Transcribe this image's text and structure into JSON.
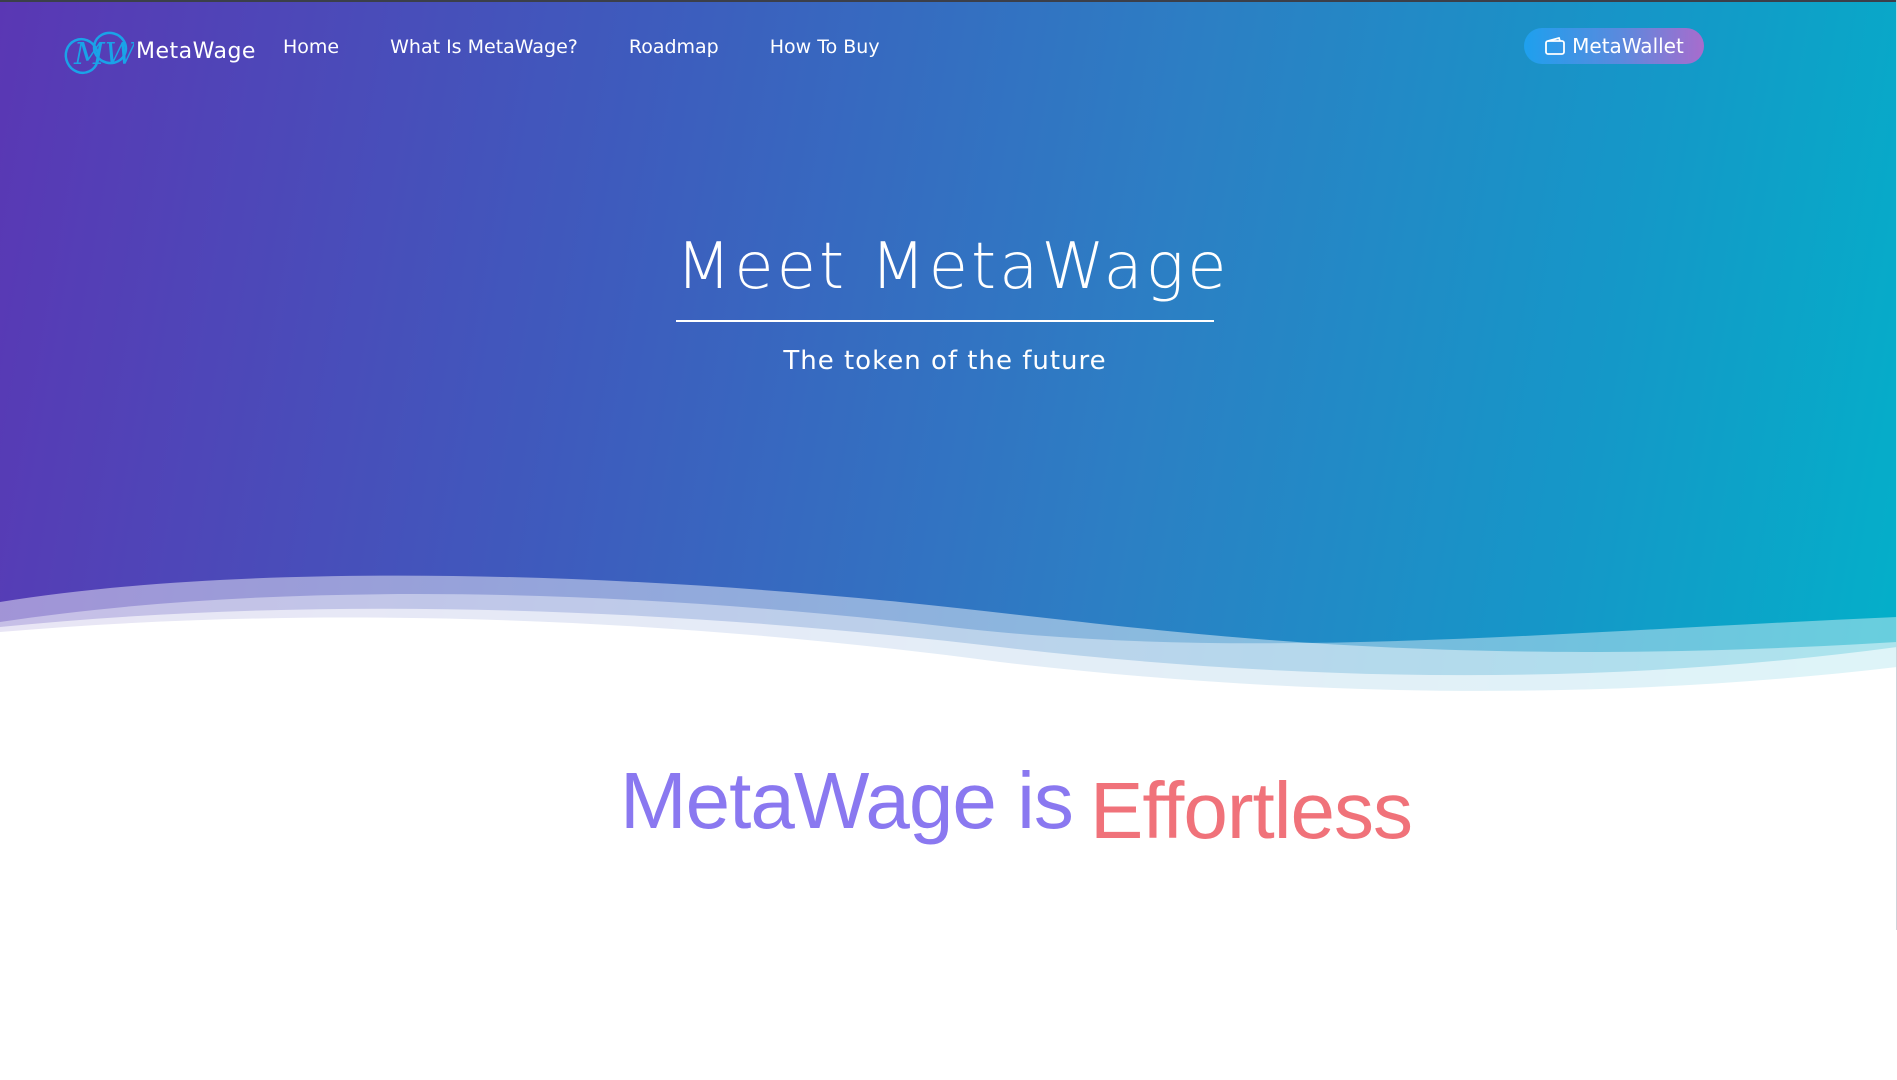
{
  "brand": {
    "logo_letters": "MW",
    "name": "MetaWage"
  },
  "nav": {
    "items": [
      {
        "label": "Home"
      },
      {
        "label": "What Is MetaWage?"
      },
      {
        "label": "Roadmap"
      },
      {
        "label": "How To Buy"
      }
    ]
  },
  "wallet": {
    "label": "MetaWallet",
    "icon": "wallet-icon"
  },
  "hero": {
    "title": "Meet MetaWage",
    "subtitle": "The token of the future"
  },
  "tagline": {
    "prefix": "MetaWage is",
    "highlight": "Effortless"
  },
  "colors": {
    "hero_gradient_start": "#5a37b4",
    "hero_gradient_end": "#03b0c9",
    "tagline_prefix": "#8a78f0",
    "tagline_highlight": "#f0727a",
    "wallet_gradient_start": "#1ea0ee",
    "wallet_gradient_end": "#a86ccd"
  }
}
